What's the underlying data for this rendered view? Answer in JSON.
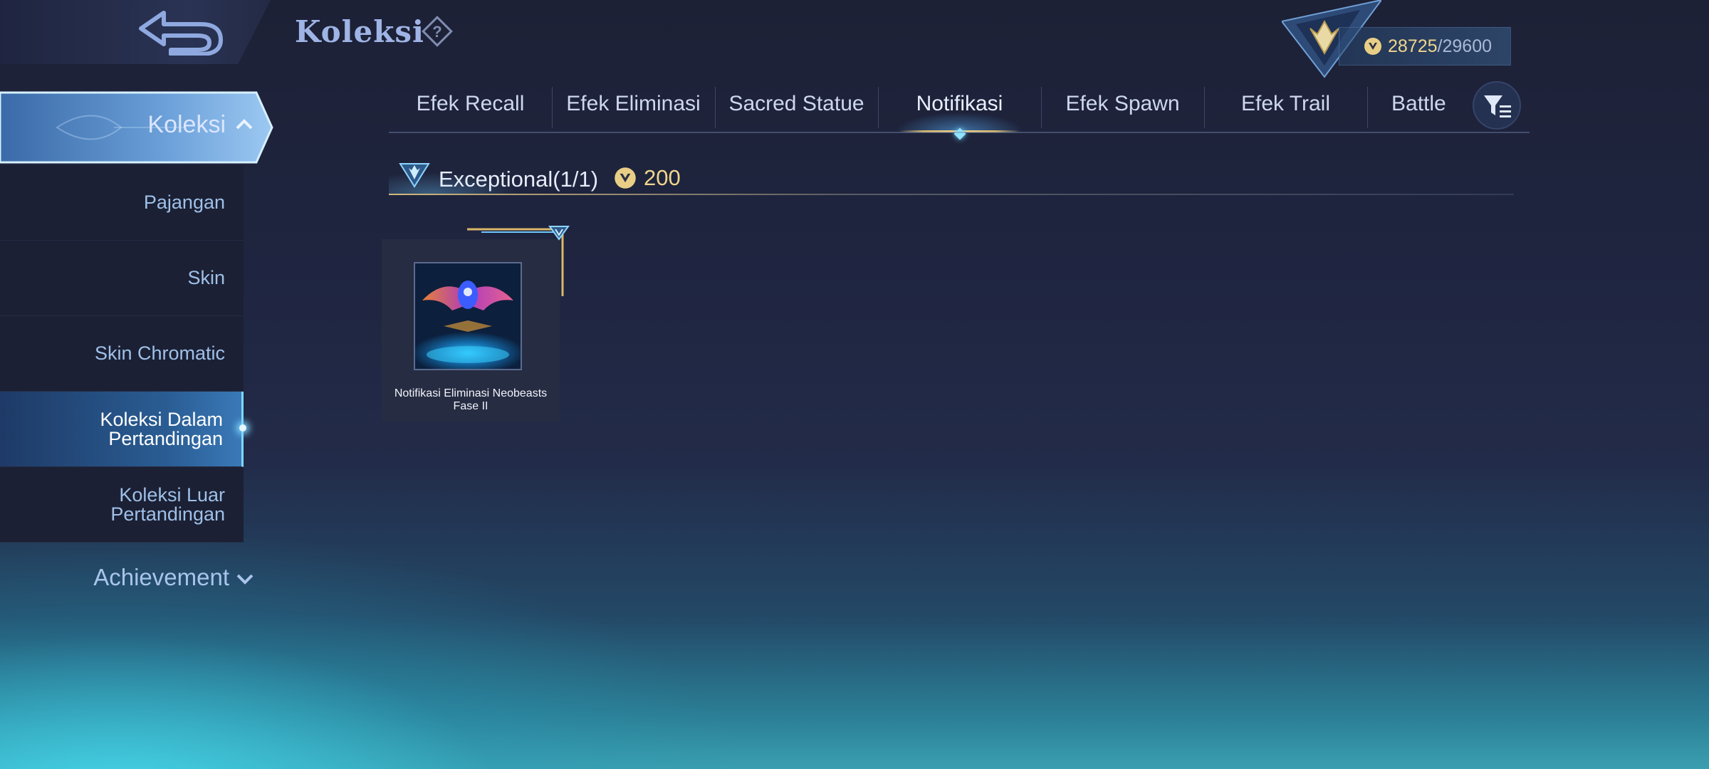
{
  "header": {
    "title": "Koleksi",
    "points": {
      "current": "28725",
      "separator": "/",
      "max": "29600"
    }
  },
  "sidebar": {
    "active_group": "Koleksi",
    "items": [
      {
        "label": "Pajangan"
      },
      {
        "label": "Skin"
      },
      {
        "label": "Skin Chromatic"
      },
      {
        "label": "Koleksi Dalam Pertandingan",
        "selected": true
      },
      {
        "label": "Koleksi Luar Pertandingan"
      }
    ],
    "achievement": "Achievement"
  },
  "tabs": [
    {
      "label": "Efek Recall"
    },
    {
      "label": "Efek Eliminasi"
    },
    {
      "label": "Sacred Statue"
    },
    {
      "label": "Notifikasi",
      "active": true
    },
    {
      "label": "Efek Spawn"
    },
    {
      "label": "Efek Trail"
    },
    {
      "label": "Battle"
    }
  ],
  "section": {
    "rank": "Exceptional",
    "count": "(1/1)",
    "cost": "200"
  },
  "items": [
    {
      "name": "Notifikasi Eliminasi Neobeasts Fase II"
    }
  ],
  "colors": {
    "accent_gold": "#f0d68c",
    "accent_cyan": "#7fd8ff",
    "selected_bg": "#2a5d94"
  },
  "icons": {
    "back": "back-arrow-icon",
    "help": "help-diamond-icon",
    "rank": "rank-emblem-icon",
    "coin": "collection-coin-icon",
    "filter": "filter-icon",
    "chevron_up": "chevron-up-icon",
    "chevron_down": "chevron-down-icon"
  }
}
